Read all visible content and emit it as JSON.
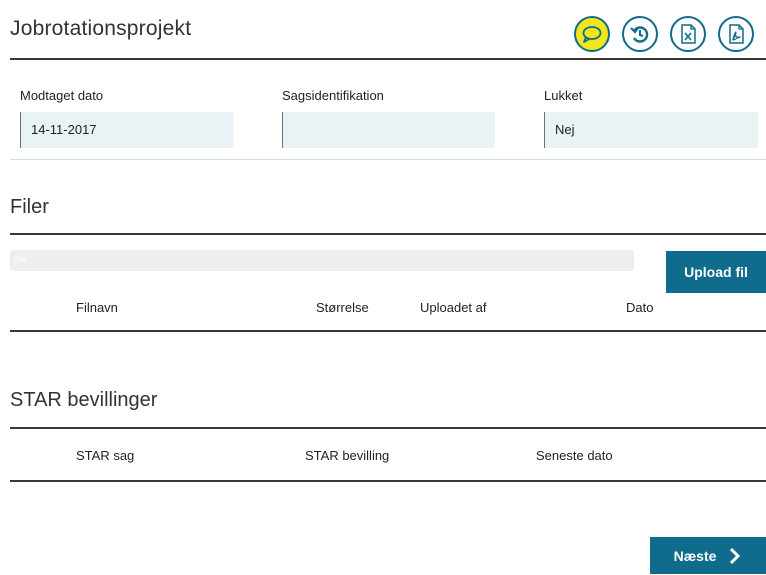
{
  "page": {
    "title": "Jobrotationsprojekt"
  },
  "toolbar": {
    "icons": [
      "comment-icon",
      "history-icon",
      "excel-export-icon",
      "pdf-export-icon"
    ],
    "colors": {
      "accent": "#0f6c8c",
      "active": "#f4e61c"
    }
  },
  "fields": {
    "received_date": {
      "label": "Modtaget dato",
      "value": "14-11-2017"
    },
    "case_id": {
      "label": "Sagsidentifikation",
      "value": ""
    },
    "closed": {
      "label": "Lukket",
      "value": "Nej"
    }
  },
  "files": {
    "title": "Filer",
    "progress_text": "0%",
    "upload_label": "Upload fil",
    "columns": [
      "Filnavn",
      "Størrelse",
      "Uploadet af",
      "Dato"
    ]
  },
  "star": {
    "title": "STAR bevillinger",
    "columns": [
      "STAR sag",
      "STAR bevilling",
      "Seneste dato"
    ]
  },
  "footer": {
    "next_label": "Næste"
  }
}
